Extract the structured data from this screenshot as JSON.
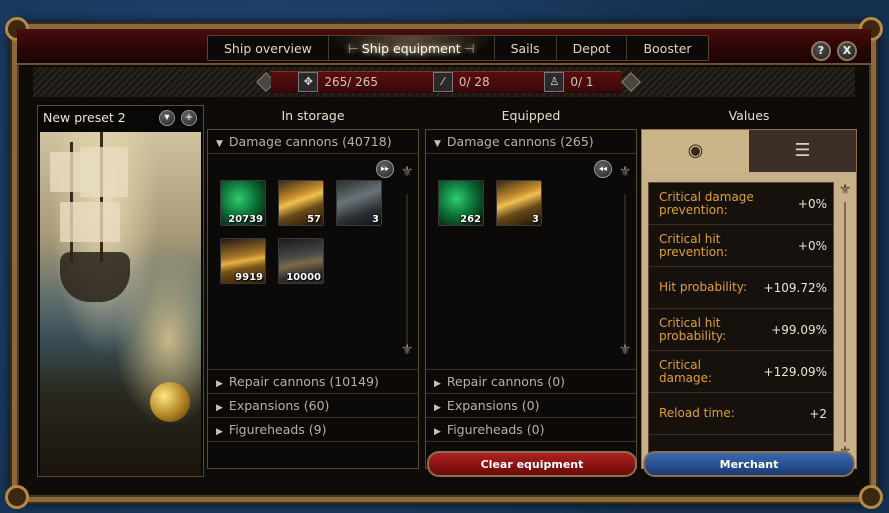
{
  "nav": {
    "tabs": [
      {
        "label": "Ship overview"
      },
      {
        "label": "Ship equipment"
      },
      {
        "label": "Sails"
      },
      {
        "label": "Depot"
      },
      {
        "label": "Booster"
      }
    ],
    "active_marker": "⊢",
    "active_marker_end": "⊣",
    "help": "?",
    "close": "X"
  },
  "resources": [
    {
      "icon": "cannon-slots-icon",
      "glyph": "✥",
      "value": "265/ 265"
    },
    {
      "icon": "ammo-icon",
      "glyph": "⁄",
      "value": "0/ 28"
    },
    {
      "icon": "figurehead-icon",
      "glyph": "♙",
      "value": "0/ 1"
    }
  ],
  "columns": {
    "storage": "In storage",
    "equipped": "Equipped",
    "values": "Values"
  },
  "preset": {
    "name": "New preset 2",
    "dropdown": "▾",
    "add": "+"
  },
  "storage": {
    "open_category": "Damage cannons (40718)",
    "items": [
      {
        "kind": "green",
        "count": "20739"
      },
      {
        "kind": "gold",
        "count": "57"
      },
      {
        "kind": "dark",
        "count": "3"
      },
      {
        "kind": "tube",
        "count": "9919"
      },
      {
        "kind": "grey",
        "count": "10000"
      }
    ],
    "categories": [
      "Repair cannons (10149)",
      "Expansions (60)",
      "Figureheads (9)"
    ],
    "skip": "▸▸"
  },
  "equipped": {
    "open_category": "Damage cannons (265)",
    "items": [
      {
        "kind": "green",
        "count": "262"
      },
      {
        "kind": "gold",
        "count": "3"
      }
    ],
    "categories": [
      "Repair cannons (0)",
      "Expansions (0)",
      "Figureheads (0)"
    ],
    "skip": "◂◂"
  },
  "values": {
    "tab_eye": "◉",
    "tab_list": "☰",
    "rows": [
      {
        "label": "Critical damage prevention:",
        "value": "+0%"
      },
      {
        "label": "Critical hit prevention:",
        "value": "+0%"
      },
      {
        "label": "Hit probability:",
        "value": "+109.72%"
      },
      {
        "label": "Critical hit probability:",
        "value": "+99.09%"
      },
      {
        "label": "Critical damage:",
        "value": "+129.09%"
      },
      {
        "label": "Reload time:",
        "value": "+2"
      }
    ]
  },
  "buttons": {
    "clear": "Clear equipment",
    "merchant": "Merchant"
  },
  "colors": {
    "accent_red": "#6a0a0a",
    "accent_blue": "#1a3a70",
    "value_label": "#e0a030"
  }
}
